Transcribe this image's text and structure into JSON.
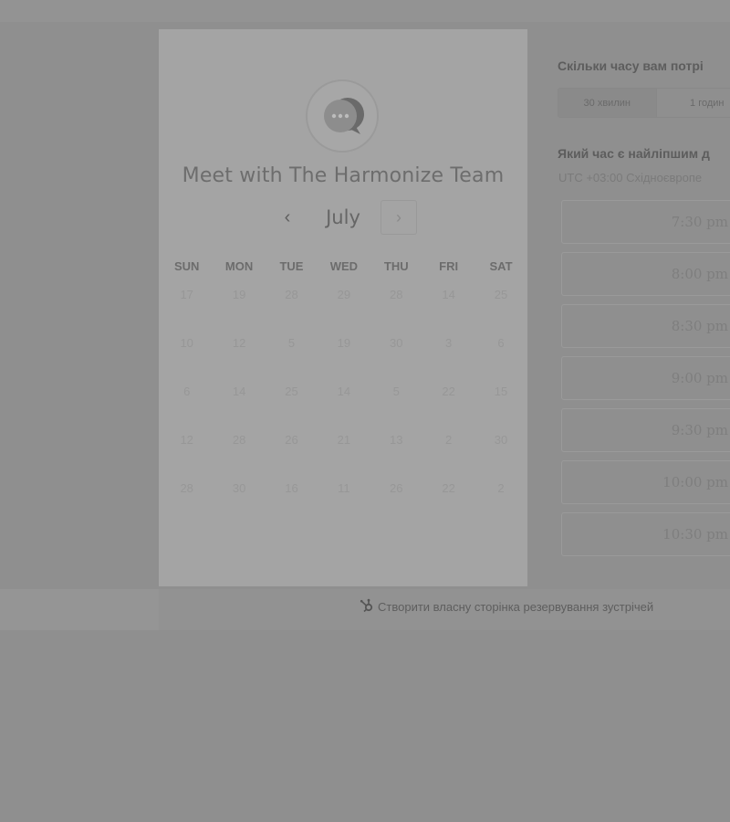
{
  "card": {
    "title": "Meet with The Harmonize Team",
    "month": "July",
    "prev_icon": "chevron-left-icon",
    "next_icon": "chevron-right-icon",
    "days_of_week": [
      "SUN",
      "MON",
      "TUE",
      "WED",
      "THU",
      "FRI",
      "SAT"
    ],
    "weeks": [
      [
        "17",
        "19",
        "28",
        "29",
        "28",
        "14",
        "25"
      ],
      [
        "10",
        "12",
        "5",
        "19",
        "30",
        "3",
        "6"
      ],
      [
        "6",
        "14",
        "25",
        "14",
        "5",
        "22",
        "15"
      ],
      [
        "12",
        "28",
        "26",
        "21",
        "13",
        "2",
        "30"
      ],
      [
        "28",
        "30",
        "16",
        "11",
        "26",
        "22",
        "2"
      ]
    ]
  },
  "panel": {
    "duration_question": "Скільки часу вам потрі",
    "durations": [
      "30 хвилин",
      "1 годин"
    ],
    "time_question": "Який час є найліпшим д",
    "timezone": "UTC +03:00 Східноєвропе",
    "slots": [
      "7:30 pm",
      "8:00 pm",
      "8:30 pm",
      "9:00 pm",
      "9:30 pm",
      "10:00 pm",
      "10:30 pm"
    ]
  },
  "footer": {
    "link_text": "Створити власну сторінка резервування зустрічей",
    "icon": "hubspot-sprocket-icon"
  }
}
